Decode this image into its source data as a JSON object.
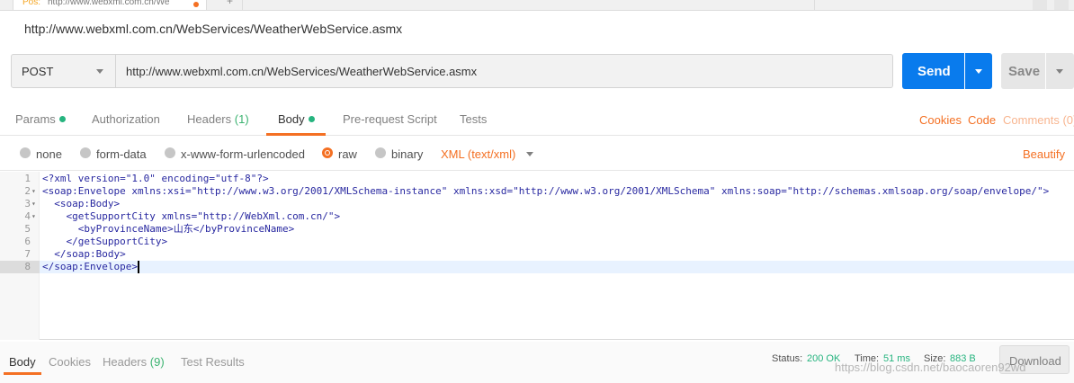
{
  "tab": {
    "method": "Pos:",
    "url": "http://www.webxml.com.cn/We",
    "new_tab": "+"
  },
  "request_title": "http://www.webxml.com.cn/WebServices/WeatherWebService.asmx",
  "url_bar": {
    "method": "POST",
    "url": "http://www.webxml.com.cn/WebServices/WeatherWebService.asmx",
    "send_label": "Send",
    "save_label": "Save"
  },
  "request_tabs": {
    "params": "Params",
    "authorization": "Authorization",
    "headers": "Headers",
    "headers_count": "(1)",
    "body": "Body",
    "prerequest": "Pre-request Script",
    "tests": "Tests",
    "cookies": "Cookies",
    "code": "Code",
    "comments": "Comments (0)"
  },
  "body_types": {
    "none": "none",
    "form_data": "form-data",
    "urlencoded": "x-www-form-urlencoded",
    "raw": "raw",
    "binary": "binary",
    "content_type": "XML (text/xml)",
    "beautify": "Beautify",
    "selected": "raw"
  },
  "editor": {
    "line_numbers": [
      "1",
      "2",
      "3",
      "4",
      "5",
      "6",
      "7",
      "8"
    ],
    "lines": [
      "<?xml version=\"1.0\" encoding=\"utf-8\"?>",
      "<soap:Envelope xmlns:xsi=\"http://www.w3.org/2001/XMLSchema-instance\" xmlns:xsd=\"http://www.w3.org/2001/XMLSchema\" xmlns:soap=\"http://schemas.xmlsoap.org/soap/envelope/\">",
      "  <soap:Body>",
      "    <getSupportCity xmlns=\"http://WebXml.com.cn/\">",
      "      <byProvinceName>山东</byProvinceName>",
      "    </getSupportCity>",
      "  </soap:Body>",
      "</soap:Envelope>"
    ]
  },
  "response": {
    "tabs": {
      "body": "Body",
      "cookies": "Cookies",
      "headers": "Headers",
      "headers_count": "(9)",
      "test_results": "Test Results"
    },
    "status_label": "Status:",
    "status_value": "200 OK",
    "time_label": "Time:",
    "time_value": "51 ms",
    "size_label": "Size:",
    "size_value": "883 B",
    "download_label": "Download",
    "watermark": "https://blog.csdn.net/baocaoren92wd"
  },
  "colors": {
    "accent": "#f47023",
    "send_blue": "#097bed",
    "success_green": "#26b47f"
  }
}
